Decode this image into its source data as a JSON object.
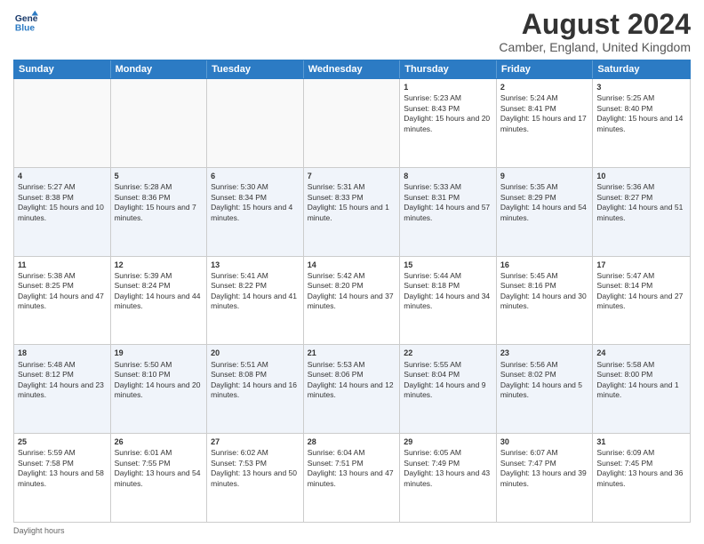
{
  "header": {
    "logo_line1": "General",
    "logo_line2": "Blue",
    "month_title": "August 2024",
    "location": "Camber, England, United Kingdom"
  },
  "days_of_week": [
    "Sunday",
    "Monday",
    "Tuesday",
    "Wednesday",
    "Thursday",
    "Friday",
    "Saturday"
  ],
  "weeks": [
    [
      {
        "day": "",
        "empty": true
      },
      {
        "day": "",
        "empty": true
      },
      {
        "day": "",
        "empty": true
      },
      {
        "day": "",
        "empty": true
      },
      {
        "day": "1",
        "sunrise": "5:23 AM",
        "sunset": "8:43 PM",
        "daylight": "15 hours and 20 minutes."
      },
      {
        "day": "2",
        "sunrise": "5:24 AM",
        "sunset": "8:41 PM",
        "daylight": "15 hours and 17 minutes."
      },
      {
        "day": "3",
        "sunrise": "5:25 AM",
        "sunset": "8:40 PM",
        "daylight": "15 hours and 14 minutes."
      }
    ],
    [
      {
        "day": "4",
        "sunrise": "5:27 AM",
        "sunset": "8:38 PM",
        "daylight": "15 hours and 10 minutes."
      },
      {
        "day": "5",
        "sunrise": "5:28 AM",
        "sunset": "8:36 PM",
        "daylight": "15 hours and 7 minutes."
      },
      {
        "day": "6",
        "sunrise": "5:30 AM",
        "sunset": "8:34 PM",
        "daylight": "15 hours and 4 minutes."
      },
      {
        "day": "7",
        "sunrise": "5:31 AM",
        "sunset": "8:33 PM",
        "daylight": "15 hours and 1 minute."
      },
      {
        "day": "8",
        "sunrise": "5:33 AM",
        "sunset": "8:31 PM",
        "daylight": "14 hours and 57 minutes."
      },
      {
        "day": "9",
        "sunrise": "5:35 AM",
        "sunset": "8:29 PM",
        "daylight": "14 hours and 54 minutes."
      },
      {
        "day": "10",
        "sunrise": "5:36 AM",
        "sunset": "8:27 PM",
        "daylight": "14 hours and 51 minutes."
      }
    ],
    [
      {
        "day": "11",
        "sunrise": "5:38 AM",
        "sunset": "8:25 PM",
        "daylight": "14 hours and 47 minutes."
      },
      {
        "day": "12",
        "sunrise": "5:39 AM",
        "sunset": "8:24 PM",
        "daylight": "14 hours and 44 minutes."
      },
      {
        "day": "13",
        "sunrise": "5:41 AM",
        "sunset": "8:22 PM",
        "daylight": "14 hours and 41 minutes."
      },
      {
        "day": "14",
        "sunrise": "5:42 AM",
        "sunset": "8:20 PM",
        "daylight": "14 hours and 37 minutes."
      },
      {
        "day": "15",
        "sunrise": "5:44 AM",
        "sunset": "8:18 PM",
        "daylight": "14 hours and 34 minutes."
      },
      {
        "day": "16",
        "sunrise": "5:45 AM",
        "sunset": "8:16 PM",
        "daylight": "14 hours and 30 minutes."
      },
      {
        "day": "17",
        "sunrise": "5:47 AM",
        "sunset": "8:14 PM",
        "daylight": "14 hours and 27 minutes."
      }
    ],
    [
      {
        "day": "18",
        "sunrise": "5:48 AM",
        "sunset": "8:12 PM",
        "daylight": "14 hours and 23 minutes."
      },
      {
        "day": "19",
        "sunrise": "5:50 AM",
        "sunset": "8:10 PM",
        "daylight": "14 hours and 20 minutes."
      },
      {
        "day": "20",
        "sunrise": "5:51 AM",
        "sunset": "8:08 PM",
        "daylight": "14 hours and 16 minutes."
      },
      {
        "day": "21",
        "sunrise": "5:53 AM",
        "sunset": "8:06 PM",
        "daylight": "14 hours and 12 minutes."
      },
      {
        "day": "22",
        "sunrise": "5:55 AM",
        "sunset": "8:04 PM",
        "daylight": "14 hours and 9 minutes."
      },
      {
        "day": "23",
        "sunrise": "5:56 AM",
        "sunset": "8:02 PM",
        "daylight": "14 hours and 5 minutes."
      },
      {
        "day": "24",
        "sunrise": "5:58 AM",
        "sunset": "8:00 PM",
        "daylight": "14 hours and 1 minute."
      }
    ],
    [
      {
        "day": "25",
        "sunrise": "5:59 AM",
        "sunset": "7:58 PM",
        "daylight": "13 hours and 58 minutes."
      },
      {
        "day": "26",
        "sunrise": "6:01 AM",
        "sunset": "7:55 PM",
        "daylight": "13 hours and 54 minutes."
      },
      {
        "day": "27",
        "sunrise": "6:02 AM",
        "sunset": "7:53 PM",
        "daylight": "13 hours and 50 minutes."
      },
      {
        "day": "28",
        "sunrise": "6:04 AM",
        "sunset": "7:51 PM",
        "daylight": "13 hours and 47 minutes."
      },
      {
        "day": "29",
        "sunrise": "6:05 AM",
        "sunset": "7:49 PM",
        "daylight": "13 hours and 43 minutes."
      },
      {
        "day": "30",
        "sunrise": "6:07 AM",
        "sunset": "7:47 PM",
        "daylight": "13 hours and 39 minutes."
      },
      {
        "day": "31",
        "sunrise": "6:09 AM",
        "sunset": "7:45 PM",
        "daylight": "13 hours and 36 minutes."
      }
    ]
  ],
  "footer": "Daylight hours"
}
